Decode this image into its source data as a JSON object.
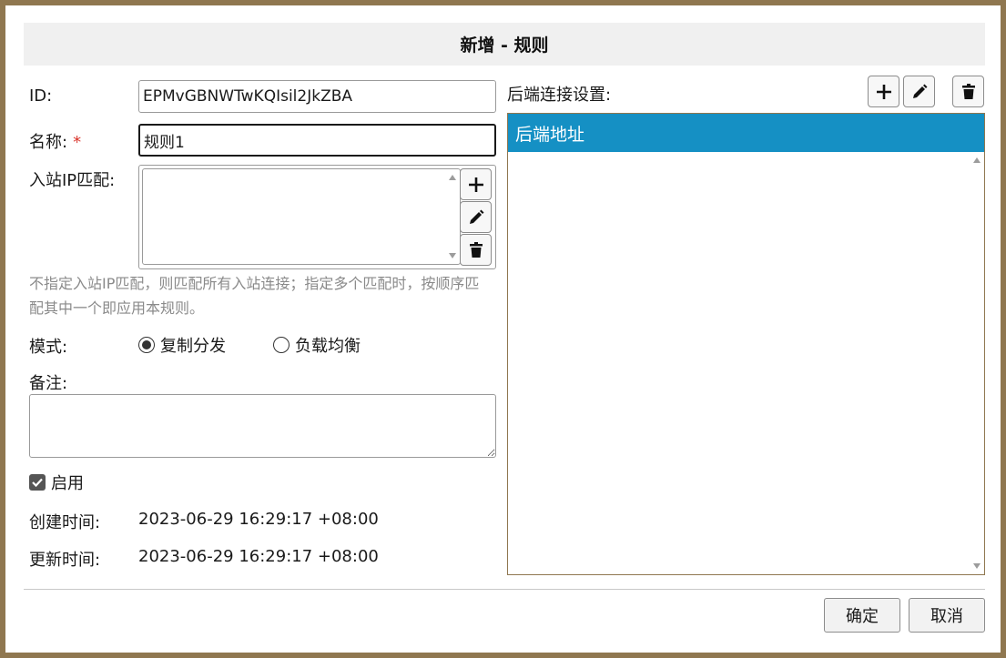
{
  "dialog": {
    "title": "新增 - 规则"
  },
  "form": {
    "id_label": "ID:",
    "id_value": "EPMvGBNWTwKQIsil2JkZBA",
    "name_label": "名称:",
    "required_mark": "*",
    "name_value": "规则1",
    "inbound_label": "入站IP匹配:",
    "inbound_hint": "不指定入站IP匹配，则匹配所有入站连接；指定多个匹配时，按顺序匹配其中一个即应用本规则。",
    "mode_label": "模式:",
    "mode_options": [
      {
        "label": "复制分发",
        "selected": true
      },
      {
        "label": "负载均衡",
        "selected": false
      }
    ],
    "remark_label": "备注:",
    "remark_value": "",
    "enable_label": "启用",
    "enabled": true,
    "created_label": "创建时间:",
    "created_value": "2023-06-29 16:29:17 +08:00",
    "updated_label": "更新时间:",
    "updated_value": "2023-06-29 16:29:17 +08:00"
  },
  "backend": {
    "label": "后端连接设置:",
    "column_header": "后端地址"
  },
  "footer": {
    "ok_label": "确定",
    "cancel_label": "取消"
  },
  "colors": {
    "accent": "#1590c4",
    "frame": "#8f7750",
    "required": "#d9342b"
  },
  "icons": [
    "plus-icon",
    "pencil-icon",
    "trash-icon",
    "checkmark-icon"
  ]
}
